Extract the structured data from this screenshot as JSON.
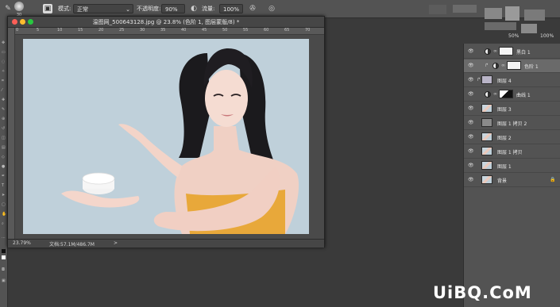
{
  "optionsbar": {
    "brush_size": "30",
    "mode_label": "模式:",
    "mode_value": "正常",
    "opacity_label": "不透明度:",
    "opacity_value": "90%",
    "flow_label": "流量:",
    "flow_value": "100%"
  },
  "document": {
    "title": "温图网_500643128.jpg @ 23.8% (色阶 1, 图层蒙版/8) *",
    "ruler_marks": [
      "0",
      "5",
      "10",
      "15",
      "20",
      "25",
      "30",
      "35",
      "40",
      "45",
      "50",
      "55",
      "60",
      "65",
      "70"
    ],
    "zoom": "23.79%",
    "doc_size": "文档:57.1M/486.7M",
    "status_arrow": ">"
  },
  "layers": [
    {
      "name": "黑白 1",
      "type": "adjustment"
    },
    {
      "name": "色阶 1",
      "type": "adjustment-clip"
    },
    {
      "name": "图层 4",
      "type": "clip"
    },
    {
      "name": "曲线 1",
      "type": "adjustment"
    },
    {
      "name": "图层 3",
      "type": "photo"
    },
    {
      "name": "图层 1 拷贝 2",
      "type": "gray"
    },
    {
      "name": "图层 2",
      "type": "photo"
    },
    {
      "name": "图层 1 拷贝",
      "type": "photo"
    },
    {
      "name": "图层 1",
      "type": "photo"
    },
    {
      "name": "背景",
      "type": "photo"
    }
  ],
  "panel_top": {
    "label1": "50%",
    "label2": "100%"
  },
  "watermark": "UiBQ.CoM",
  "colors": {
    "photo_bg": "#bfd0da",
    "panel_bg": "#535353",
    "workspace": "#3a3a3a"
  }
}
